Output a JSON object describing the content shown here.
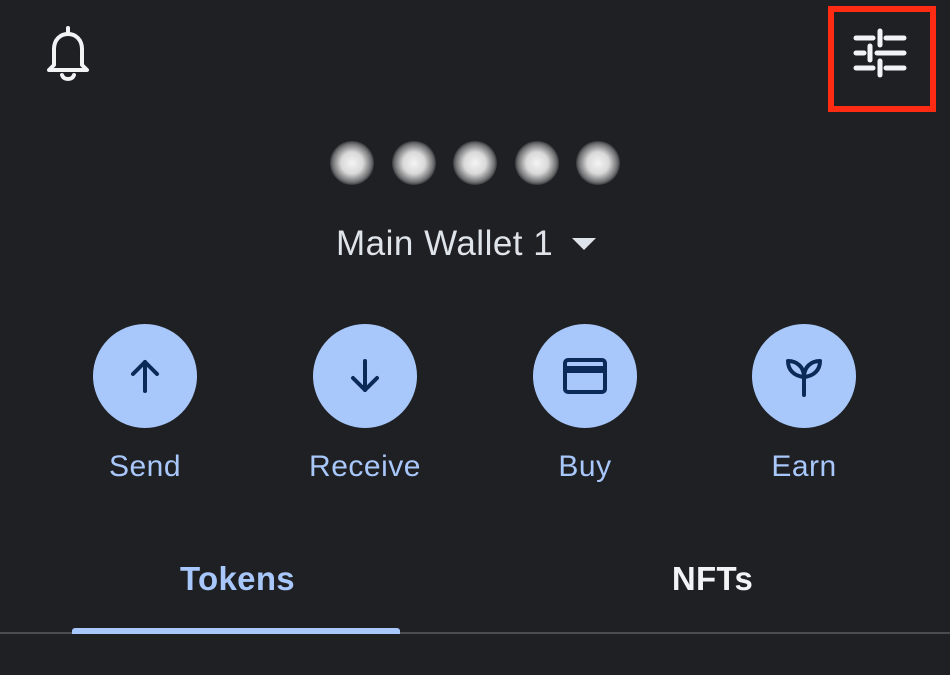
{
  "header": {
    "notifications_icon": "bell-icon",
    "settings_icon": "tune-sliders-icon",
    "highlight_color": "#ff2b13"
  },
  "balance": {
    "hidden": true,
    "mask": "•••••"
  },
  "wallet": {
    "name": "Main Wallet 1",
    "dropdown_icon": "caret-down-icon"
  },
  "actions": [
    {
      "label": "Send",
      "icon": "arrow-up-icon"
    },
    {
      "label": "Receive",
      "icon": "arrow-down-icon"
    },
    {
      "label": "Buy",
      "icon": "credit-card-icon"
    },
    {
      "label": "Earn",
      "icon": "sprout-icon"
    }
  ],
  "tabs": [
    {
      "label": "Tokens",
      "selected": true
    },
    {
      "label": "NFTs",
      "selected": false
    }
  ],
  "colors": {
    "background": "#1f2023",
    "accent": "#a8c7fa",
    "icon_dark": "#0b2a57",
    "text_primary": "#f1f3f4"
  }
}
